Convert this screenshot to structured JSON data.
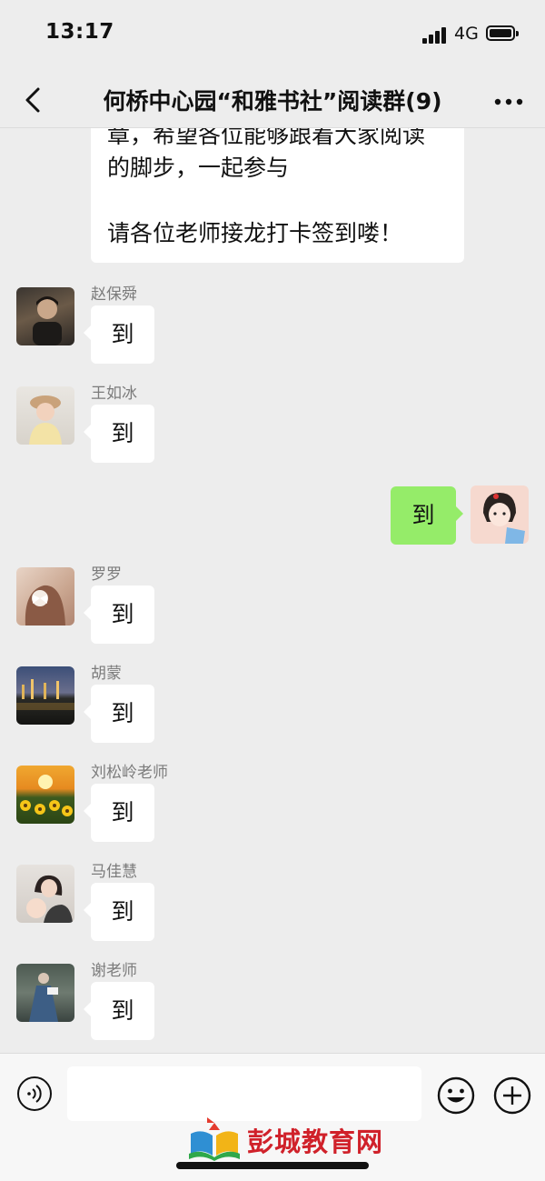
{
  "status_bar": {
    "time": "13:17",
    "network": "4G"
  },
  "header": {
    "title": "何桥中心园“和雅书社”阅读群(9)"
  },
  "pinned_message": {
    "lines": [
      "章，希望各位能够跟着大家阅读",
      "的脚步，一起参与",
      "",
      "请各位老师接龙打卡签到喽！"
    ]
  },
  "messages": [
    {
      "sender": "赵保舜",
      "text": "到"
    },
    {
      "sender": "王如冰",
      "text": "到"
    },
    {
      "sender": "",
      "text": "到",
      "mine": true
    },
    {
      "sender": "罗罗",
      "text": "到"
    },
    {
      "sender": "胡蒙",
      "text": "到"
    },
    {
      "sender": "刘松岭老师",
      "text": "到"
    },
    {
      "sender": "马佳慧",
      "text": "到"
    },
    {
      "sender": "谢老师",
      "text": "到"
    }
  ],
  "input": {
    "placeholder": ""
  },
  "watermark": {
    "text": "彭城教育网"
  },
  "colors": {
    "background": "#ededed",
    "own_bubble": "#95ec69",
    "other_bubble": "#ffffff",
    "watermark": "#d0212a"
  },
  "icons": [
    "back-arrow-icon",
    "more-dots-icon",
    "voice-icon",
    "emoji-icon",
    "plus-icon"
  ]
}
